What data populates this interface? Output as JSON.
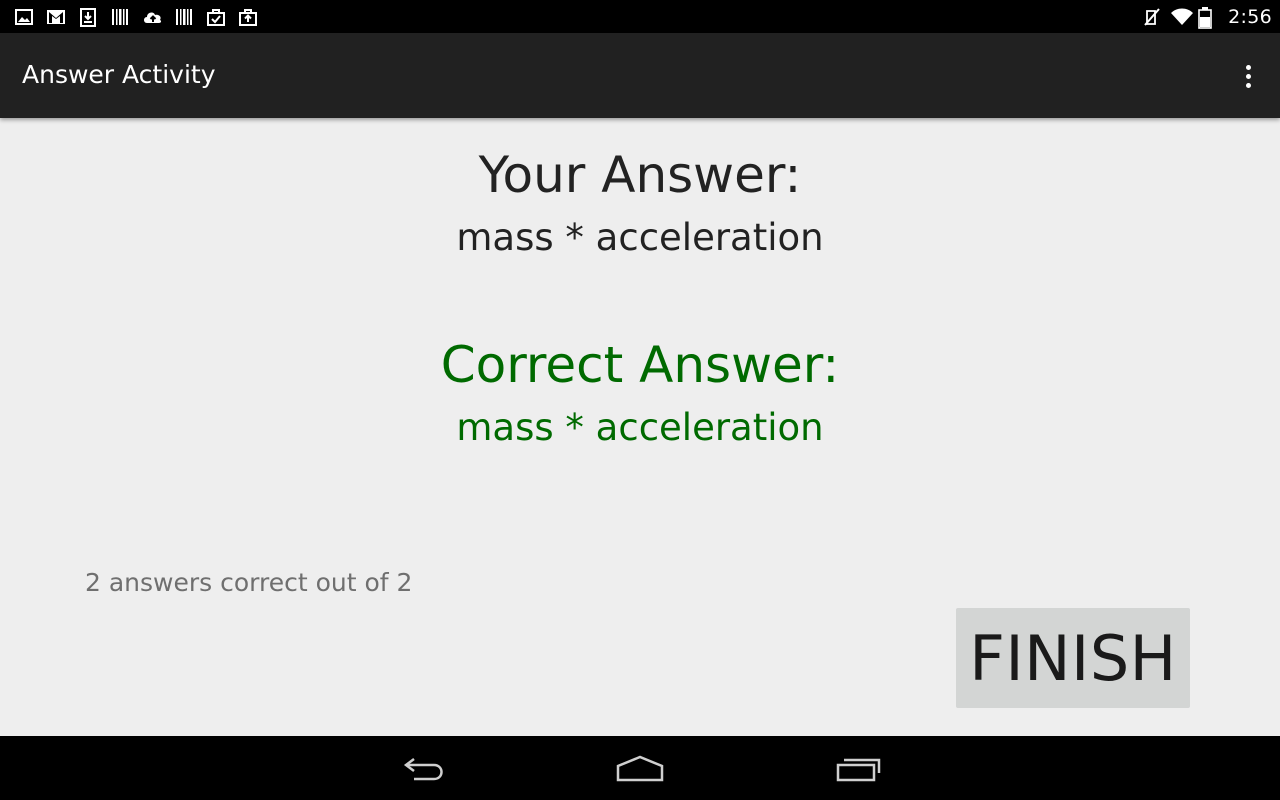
{
  "status_bar": {
    "notification_icons": [
      "image-icon",
      "gmail-icon",
      "download-icon",
      "barcode-icon",
      "cloud-upload-icon",
      "barcode-icon",
      "briefcase-check-icon",
      "briefcase-upload-icon"
    ],
    "system_icons": [
      "mute-icon",
      "wifi-icon",
      "battery-icon"
    ],
    "time": "2:56"
  },
  "action_bar": {
    "title": "Answer Activity",
    "overflow_icon": "overflow-menu-icon"
  },
  "main": {
    "your_answer_label": "Your Answer:",
    "your_answer_value": "mass * acceleration",
    "correct_answer_label": "Correct Answer:",
    "correct_answer_value": "mass * acceleration",
    "summary": "2 answers correct out of 2",
    "finish_label": "FINISH"
  },
  "nav_bar": {
    "icons": [
      "back-icon",
      "home-icon",
      "recents-icon"
    ]
  },
  "colors": {
    "background": "#eeeeee",
    "action_bar": "#212121",
    "correct": "#006a00",
    "summary_text": "#6f6f6f",
    "finish_button": "#d3d5d4"
  }
}
